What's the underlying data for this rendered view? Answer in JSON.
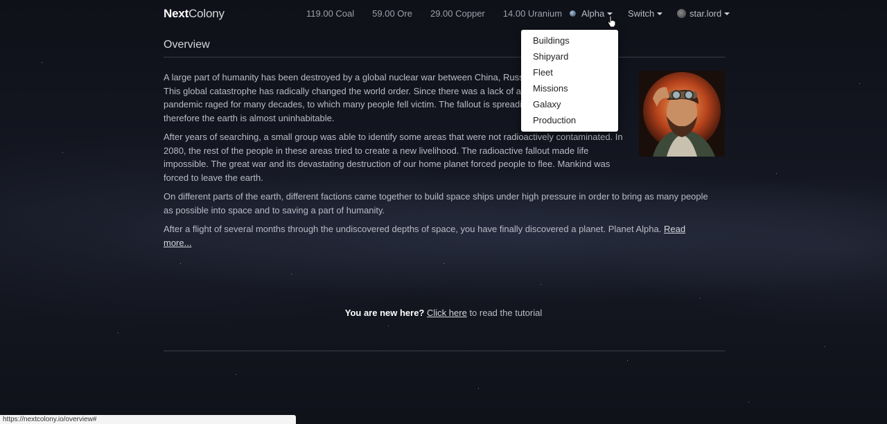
{
  "brand": {
    "bold": "Next",
    "light": "Colony"
  },
  "resources": [
    {
      "label": "119.00 Coal"
    },
    {
      "label": "59.00 Ore"
    },
    {
      "label": "29.00 Copper"
    },
    {
      "label": "14.00 Uranium"
    }
  ],
  "nav": {
    "planet": "Alpha",
    "switch": "Switch",
    "user": "star.lord"
  },
  "dropdown": {
    "items": [
      "Buildings",
      "Shipyard",
      "Fleet",
      "Missions",
      "Galaxy",
      "Production"
    ]
  },
  "page": {
    "title": "Overview",
    "paragraphs": [
      "A large part of humanity has been destroyed by a global nuclear war between China, Russia,",
      "This global catastrophe has radically changed the world order. Since there was a lack of any",
      "pandemic raged for many decades, to which many people fell victim. The fallout is spreading",
      "therefore the earth is almost uninhabitable."
    ],
    "p2": "After years of searching, a small group was able to identify some areas that were not radioactively contaminated. In 2080, the rest of the people in these areas tried to create a new livelihood. The radioactive fallout made life impossible. The great war and its devastating destruction of our home planet forced people to flee. Mankind was forced to leave the earth.",
    "p3": "On different parts of the earth, different factions came together to build space ships under high pressure in order to bring as many people as possible into space and to saving a part of humanity.",
    "p4": "After a flight of several months through the undiscovered depths of space, you have finally discovered a planet. Planet Alpha.",
    "read_more": "Read more..."
  },
  "tutorial": {
    "bold": "You are new here?",
    "link": "Click here",
    "rest": "to read the tutorial"
  },
  "status_url": "https://nextcolony.io/overview#"
}
